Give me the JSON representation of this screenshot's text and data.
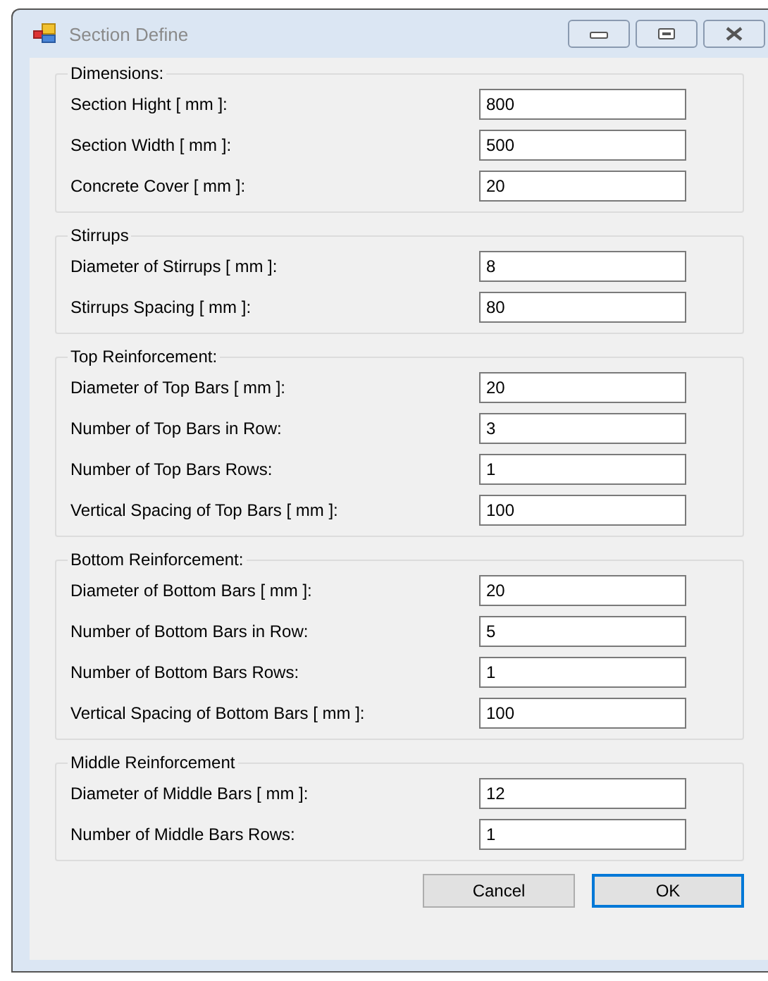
{
  "window": {
    "title": "Section Define"
  },
  "groups": [
    {
      "title": "Dimensions:",
      "fields": [
        {
          "label": "Section Hight [ mm ]:",
          "value": "800"
        },
        {
          "label": "Section Width [ mm ]:",
          "value": "500"
        },
        {
          "label": "Concrete Cover [ mm ]:",
          "value": "20"
        }
      ]
    },
    {
      "title": "Stirrups",
      "fields": [
        {
          "label": "Diameter of Stirrups [ mm ]:",
          "value": "8"
        },
        {
          "label": "Stirrups Spacing [ mm ]:",
          "value": "80"
        }
      ]
    },
    {
      "title": "Top Reinforcement:",
      "fields": [
        {
          "label": "Diameter of Top Bars  [ mm ]:",
          "value": "20"
        },
        {
          "label": "Number of Top Bars in Row:",
          "value": "3"
        },
        {
          "label": "Number of Top Bars Rows:",
          "value": "1"
        },
        {
          "label": "Vertical Spacing of Top Bars [ mm ]:",
          "value": "100"
        }
      ]
    },
    {
      "title": "Bottom Reinforcement:",
      "fields": [
        {
          "label": "Diameter of Bottom Bars [ mm ]:",
          "value": "20"
        },
        {
          "label": "Number of Bottom Bars in Row:",
          "value": "5"
        },
        {
          "label": "Number of Bottom Bars Rows:",
          "value": "1"
        },
        {
          "label": "Vertical Spacing of Bottom Bars [ mm ]:",
          "value": "100"
        }
      ]
    },
    {
      "title": "Middle Reinforcement",
      "fields": [
        {
          "label": "Diameter of Middle Bars [ mm ]:",
          "value": "12"
        },
        {
          "label": "Number of Middle Bars Rows:",
          "value": "1"
        }
      ]
    }
  ],
  "buttons": [
    {
      "label": "Cancel",
      "selected": false
    },
    {
      "label": "OK",
      "selected": true
    }
  ]
}
